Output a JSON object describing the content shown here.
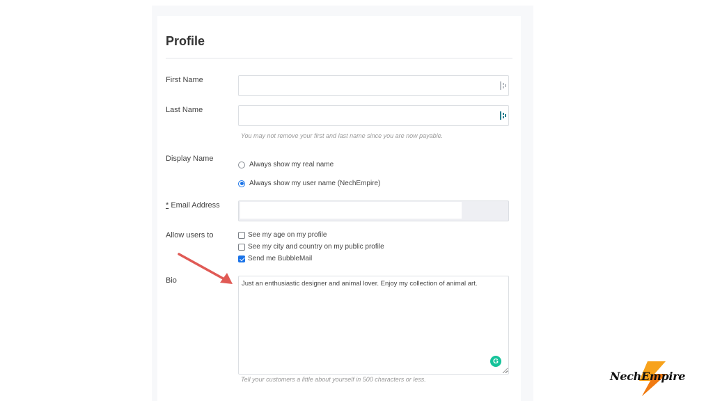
{
  "form": {
    "title": "Profile",
    "first_name": {
      "label": "First Name",
      "value": "",
      "placeholder": ""
    },
    "last_name": {
      "label": "Last Name",
      "value": "",
      "placeholder": ""
    },
    "name_hint": "You may not remove your first and last name since you are now payable.",
    "display_name": {
      "label": "Display Name",
      "options": [
        {
          "label": "Always show my real name",
          "checked": false
        },
        {
          "label": "Always show my user name (NechEmpire)",
          "checked": true
        }
      ]
    },
    "email": {
      "label": "* Email Address",
      "required_marker": "*",
      "label_text": "Email Address",
      "value": ""
    },
    "allow_users": {
      "label": "Allow users to",
      "options": [
        {
          "label": "See my age on my profile",
          "checked": false
        },
        {
          "label": "See my city and country on my public profile",
          "checked": false
        },
        {
          "label": "Send me BubbleMail",
          "checked": true
        }
      ]
    },
    "bio": {
      "label": "Bio",
      "value": "Just an enthusiastic designer and animal lover. Enjoy my collection of animal art.",
      "hint": "Tell your customers a little about yourself in 500 characters or less."
    }
  },
  "overlay": {
    "grammarly_glyph": "G",
    "arrow_color": "#e05a55",
    "logo_text": "NechEmpire"
  },
  "colors": {
    "accent": "#1a73e8",
    "grammarly": "#15c39a",
    "logo_orange": "#f7a21b"
  }
}
